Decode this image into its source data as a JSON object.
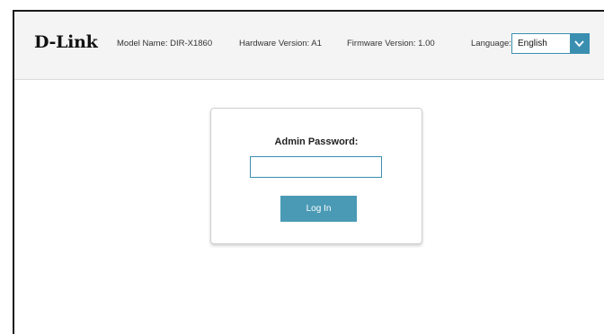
{
  "header": {
    "brand": "D-Link",
    "model": "Model Name: DIR-X1860",
    "hardware": "Hardware Version: A1",
    "firmware": "Firmware Version: 1.00",
    "language_label": "Language:",
    "language_value": "English"
  },
  "login": {
    "password_label": "Admin Password:",
    "password_value": "",
    "login_label": "Log In"
  },
  "colors": {
    "accent": "#4a9ab5",
    "header_bg": "#f4f4f4"
  },
  "icons": {
    "language_dropdown": "chevron-down-icon"
  }
}
